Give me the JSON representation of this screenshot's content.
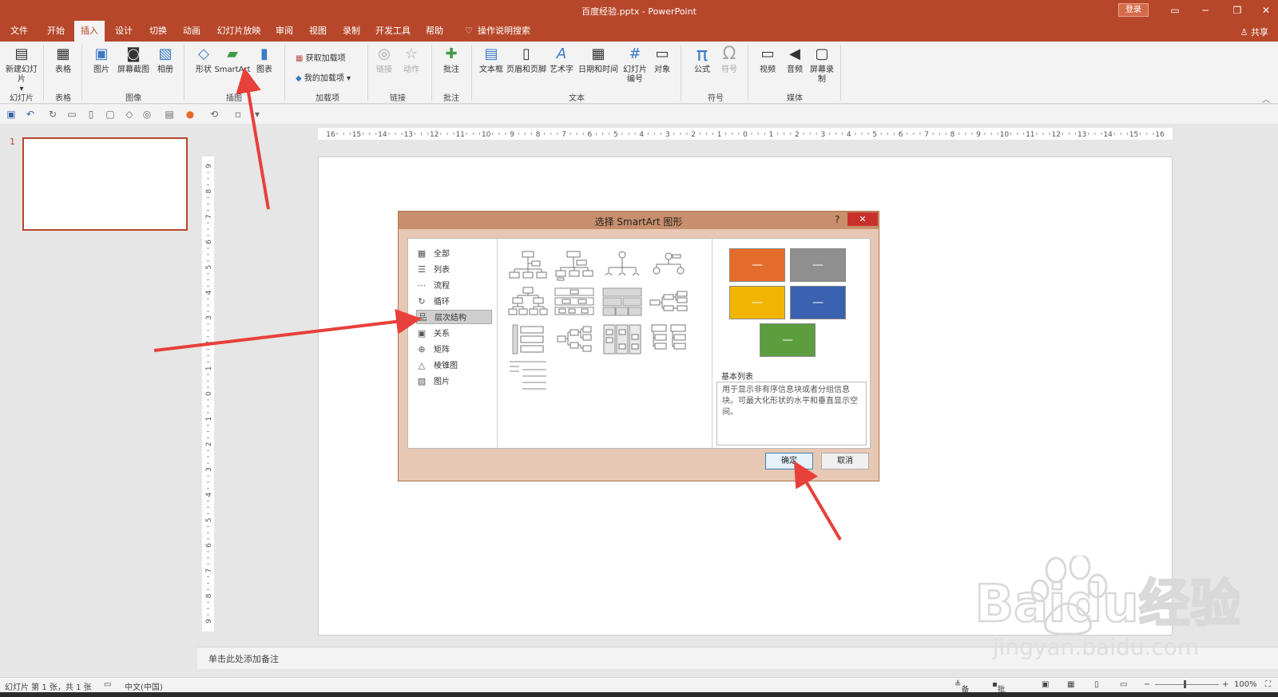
{
  "window": {
    "title": "百度经验.pptx - PowerPoint",
    "login": "登录",
    "share": "共享"
  },
  "tabs": [
    "文件",
    "开始",
    "插入",
    "设计",
    "切换",
    "动画",
    "幻灯片放映",
    "审阅",
    "视图",
    "录制",
    "开发工具",
    "帮助",
    "操作说明搜索"
  ],
  "ribbon": {
    "buttons": [
      "新建幻灯片",
      "表格",
      "图片",
      "屏幕截图",
      "相册",
      "形状",
      "SmartArt",
      "图表",
      "链接",
      "动作",
      "批注",
      "文本框",
      "页眉和页脚",
      "艺术字",
      "日期和时间",
      "幻灯片编号",
      "对象",
      "公式",
      "符号",
      "视频",
      "音频",
      "屏幕录制"
    ],
    "addins": [
      "获取加载项",
      "我的加载项"
    ],
    "groups": [
      "幻灯片",
      "表格",
      "图像",
      "插图",
      "加载项",
      "链接",
      "批注",
      "文本",
      "符号",
      "媒体"
    ]
  },
  "slides": {
    "number": "1"
  },
  "ruler": {
    "h_ticks": [
      "16",
      "15",
      "14",
      "13",
      "12",
      "11",
      "10",
      "9",
      "8",
      "7",
      "6",
      "5",
      "4",
      "3",
      "2",
      "1",
      "0",
      "1",
      "2",
      "3",
      "4",
      "5",
      "6",
      "7",
      "8",
      "9",
      "10",
      "11",
      "12",
      "13",
      "14",
      "15",
      "16"
    ],
    "v_ticks": [
      "9",
      "8",
      "7",
      "6",
      "5",
      "4",
      "3",
      "2",
      "1",
      "0",
      "1",
      "2",
      "3",
      "4",
      "5",
      "6",
      "7",
      "8",
      "9"
    ]
  },
  "dialog": {
    "title": "选择 SmartArt 图形",
    "help": "?",
    "close": "✕",
    "categories": [
      "全部",
      "列表",
      "流程",
      "循环",
      "层次结构",
      "关系",
      "矩阵",
      "棱锥图",
      "图片"
    ],
    "selected_category": "层次结构",
    "preview_title": "基本列表",
    "preview_desc": "用于显示非有序信息块或者分组信息块。可最大化形状的水平和垂直显示空间。",
    "preview_colors": [
      "#e46c2b",
      "#8f8f8f",
      "#f1b400",
      "#3a62b1",
      "#5c9e3e"
    ],
    "ok": "确定",
    "cancel": "取消"
  },
  "notes": {
    "placeholder": "单击此处添加备注"
  },
  "status": {
    "slide_info": "幻灯片 第 1 张，共 1 张",
    "language": "中文(中国)",
    "notes": "备注",
    "comments": "批注",
    "zoom": "100%"
  },
  "watermark": {
    "brand": "Baidu经验",
    "url": "jingyan.baidu.com"
  }
}
